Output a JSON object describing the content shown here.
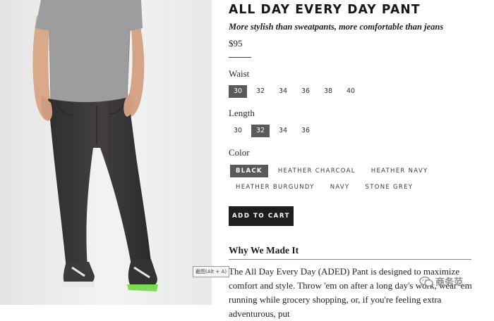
{
  "product": {
    "title": "ALL DAY EVERY DAY PANT",
    "subtitle": "More stylish than sweatpants, more comfortable than jeans",
    "price": "$95"
  },
  "options": {
    "waist": {
      "label": "Waist",
      "values": [
        "30",
        "32",
        "34",
        "36",
        "38",
        "40"
      ],
      "selected": "30"
    },
    "length": {
      "label": "Length",
      "values": [
        "30",
        "32",
        "34",
        "36"
      ],
      "selected": "32"
    },
    "color": {
      "label": "Color",
      "rows": [
        [
          "BLACK",
          "HEATHER CHARCOAL",
          "HEATHER NAVY"
        ],
        [
          "HEATHER BURGUNDY",
          "NAVY",
          "STONE GREY"
        ]
      ],
      "selected": "BLACK"
    }
  },
  "actions": {
    "add_to_cart": "ADD TO CART"
  },
  "section": {
    "title": "Why We Made It",
    "description": "The All Day Every Day (ADED) Pant is designed to maximize comfort and style. Throw 'em on after a long day's work, wear 'em running while grocery shopping, or, if you're feeling extra adventurous, put"
  },
  "overlay": {
    "tooltip": "截图(Alt + A)",
    "watermark": "商务范",
    "watermark_icon": "wechat-icon"
  },
  "colors": {
    "selected_bg": "#5a5a5a",
    "button_bg": "#1e1e1e",
    "photo_bg": "#ececec"
  }
}
